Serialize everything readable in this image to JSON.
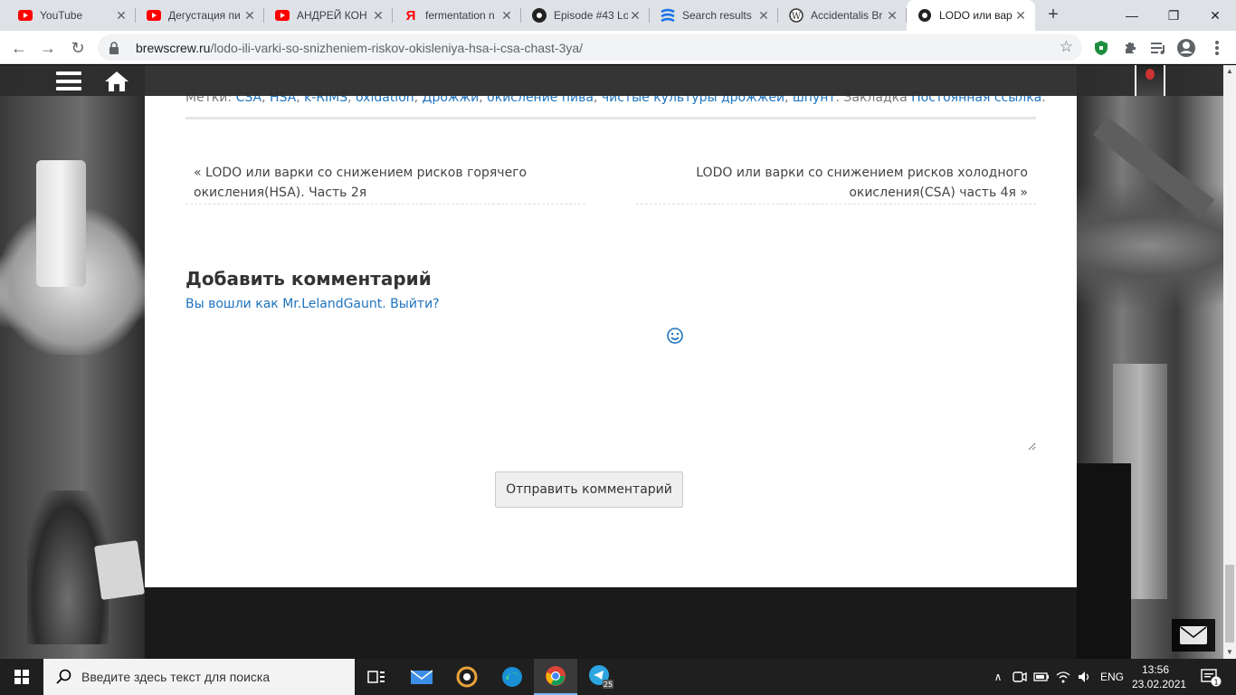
{
  "browser": {
    "tabs": [
      {
        "title": "YouTube",
        "favicon": "youtube-icon",
        "active": false
      },
      {
        "title": "Дегустация пи",
        "favicon": "youtube-icon",
        "active": false
      },
      {
        "title": "АНДРЕЙ КОН",
        "favicon": "youtube-icon",
        "active": false
      },
      {
        "title": "fermentation n",
        "favicon": "yandex-icon",
        "active": false
      },
      {
        "title": "Episode #43 Lo",
        "favicon": "podcast-icon",
        "active": false
      },
      {
        "title": "Search results",
        "favicon": "search-results-icon",
        "active": false
      },
      {
        "title": "Accidentalis Br",
        "favicon": "wordpress-icon",
        "active": false
      },
      {
        "title": "LODO или вар",
        "favicon": "brewscrew-icon",
        "active": true
      }
    ],
    "new_tab": "+",
    "address": {
      "host": "brewscrew.ru",
      "path": "/lodo-ili-varki-so-snizheniem-riskov-okisleniya-hsa-i-csa-chast-3ya/"
    }
  },
  "post": {
    "tags_label": "Метки:",
    "tags": [
      "CSA",
      "HSA",
      "k-RIMS",
      "oxidation",
      "Дрожжи",
      "окисление пива",
      "чистые культуры дрожжей",
      "шпунт"
    ],
    "bookmark_label": "Закладка",
    "permalink": "Постоянная ссылка",
    "prev_link": "LODO или варки со снижением рисков горячего окисления(HSA). Часть 2я",
    "next_link": "LODO или варки со снижением рисков холодного окисления(CSA) часть 4я"
  },
  "comments": {
    "title": "Добавить комментарий",
    "logged_in_prefix": "Вы вошли как",
    "user": "Mr.LelandGaunt",
    "logout": "Выйти?",
    "submit": "Отправить комментарий"
  },
  "taskbar": {
    "search_placeholder": "Введите здесь текст для поиска",
    "language": "ENG",
    "time": "13:56",
    "date": "23.02.2021",
    "notification_count": "1",
    "telegram_badge": "25"
  },
  "colors": {
    "link": "#1e73be",
    "tab_strip": "#dee1e6",
    "taskbar": "#1f1f1f"
  }
}
